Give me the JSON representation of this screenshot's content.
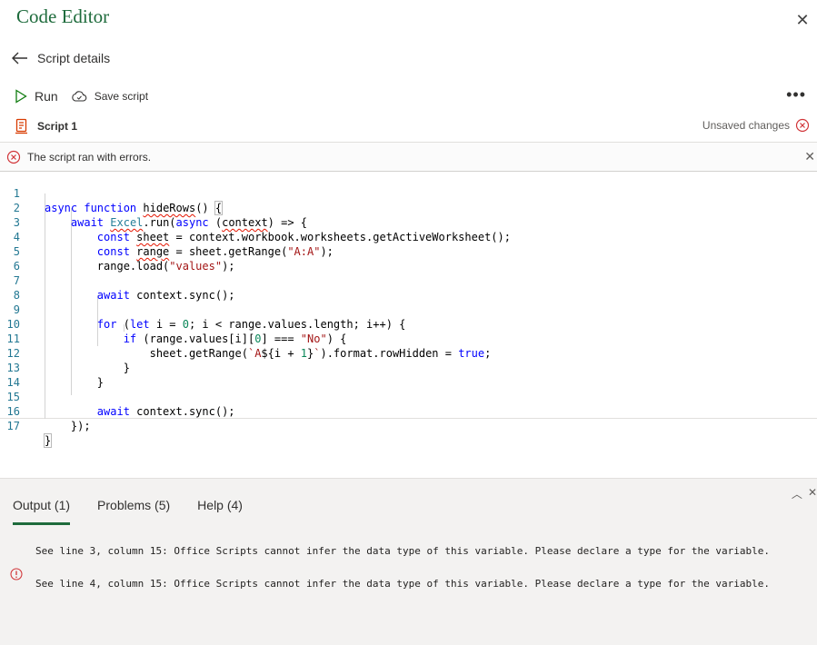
{
  "app": {
    "title": "Code Editor"
  },
  "nav": {
    "back_label": "Script details"
  },
  "toolbar": {
    "run_label": "Run",
    "save_label": "Save script",
    "more_label": "•••"
  },
  "script": {
    "name": "Script 1",
    "status": "Unsaved changes"
  },
  "error_bar": {
    "message": "The script ran with errors."
  },
  "editor": {
    "line_numbers": [
      "1",
      "2",
      "3",
      "4",
      "5",
      "6",
      "7",
      "8",
      "9",
      "10",
      "11",
      "12",
      "13",
      "14",
      "15",
      "16",
      "17"
    ]
  },
  "panel": {
    "tabs": [
      {
        "label": "Output (1)"
      },
      {
        "label": "Problems (5)"
      },
      {
        "label": "Help (4)"
      }
    ],
    "problems": [
      {
        "text": "See line 3, column 15: Office Scripts cannot infer the data type of this variable. Please declare a type for the variable."
      },
      {
        "text": "See line 4, column 15: Office Scripts cannot infer the data type of this variable. Please declare a type for the variable."
      }
    ]
  },
  "colors": {
    "accent": "#1e6b3c",
    "error": "#d13438",
    "run_green": "#107c10",
    "script_icon": "#d83b01"
  }
}
